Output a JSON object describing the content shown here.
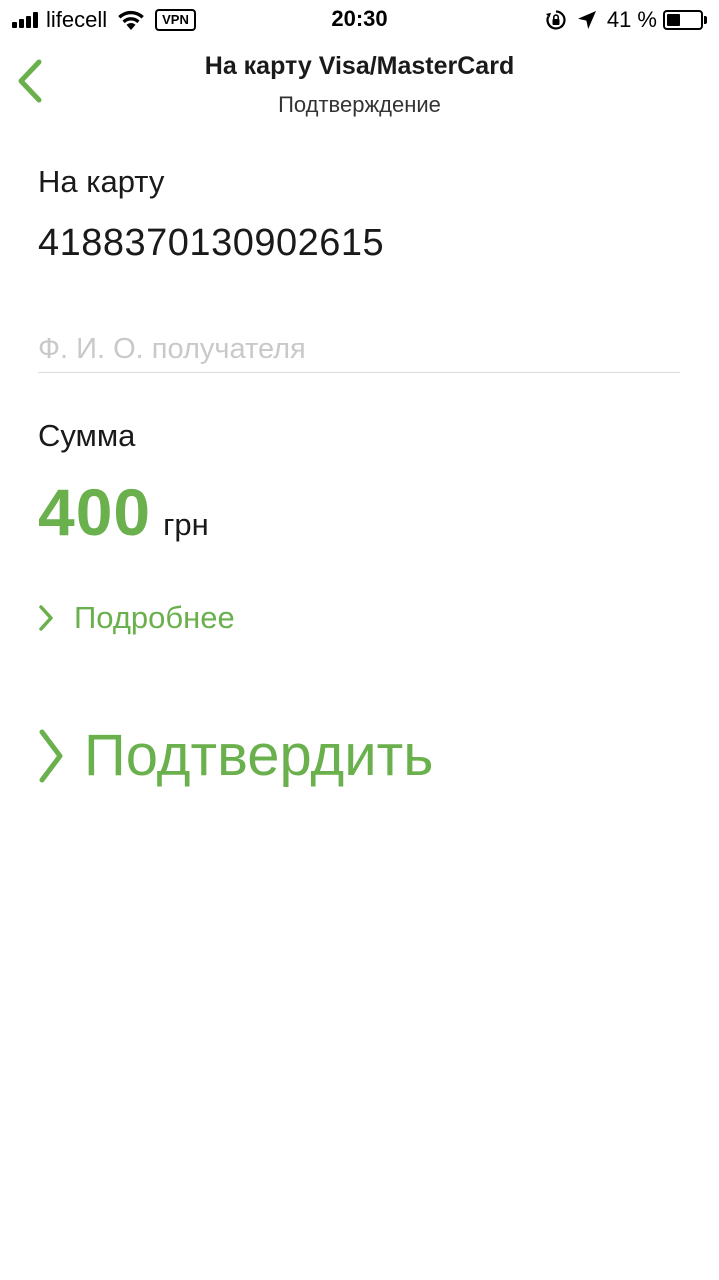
{
  "status_bar": {
    "carrier": "lifecell",
    "vpn": "VPN",
    "time": "20:30",
    "battery_percent": "41 %",
    "battery_level": 0.41,
    "icons": [
      "signal-icon",
      "wifi-icon",
      "orientation-lock-icon",
      "location-arrow-icon",
      "battery-icon"
    ]
  },
  "nav": {
    "back_icon": "chevron-left-icon",
    "title": "На карту Visa/MasterCard",
    "subtitle": "Подтверждение"
  },
  "card": {
    "label": "На карту",
    "number": "4188370130902615"
  },
  "recipient": {
    "placeholder": "Ф. И. О. получателя",
    "value": ""
  },
  "amount": {
    "label": "Сумма",
    "value": "400",
    "currency": "грн"
  },
  "details": {
    "label": "Подробнее"
  },
  "confirm": {
    "label": "Подтвердить"
  },
  "colors": {
    "accent": "#6ab04c",
    "text": "#1a1a1a",
    "placeholder": "#c9c9c9",
    "divider": "#dcdcdc"
  }
}
